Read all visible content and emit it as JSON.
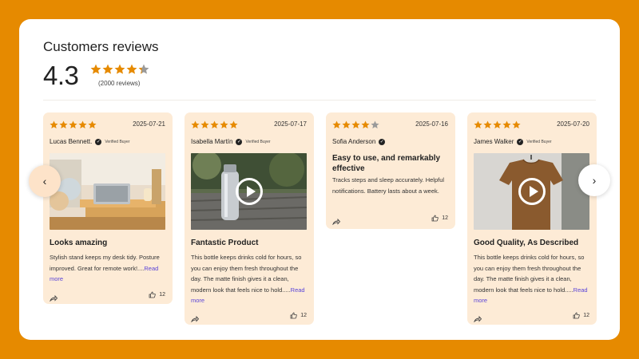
{
  "summary": {
    "title": "Customers reviews",
    "rating": "4.3",
    "rating_value": 4.3,
    "count": "(2000 reviews)"
  },
  "colors": {
    "background": "#E68A00",
    "card": "#FDEBD6",
    "star": "#E68A00",
    "star_empty": "#9a9a9a",
    "link": "#5a44d8"
  },
  "reviews": [
    {
      "stars": 5,
      "date": "2025-07-21",
      "name": "Lucas Bennett.",
      "verified": "Verified Buyer",
      "media": "photo",
      "title": "Looks amazing",
      "body": "Stylish stand keeps my desk tidy. Posture improved. Great for remote work!....",
      "more": "Read more",
      "likes": "12"
    },
    {
      "stars": 5,
      "date": "2025-07-17",
      "name": "Isabella Martín",
      "verified": "Verified Buyer",
      "media": "video",
      "title": "Fantastic Product",
      "body": "This bottle keeps drinks cold for hours, so you can enjoy them fresh throughout the day. The matte finish gives it a clean, modern look that feels nice to hold.....",
      "more": "Read more",
      "likes": "12"
    },
    {
      "stars": 4,
      "date": "2025-07-16",
      "name": "Sofia Anderson",
      "verified": "",
      "media": "none",
      "title": "Easy to use, and remarkably effective",
      "body": "Tracks steps and sleep accurately. Helpful notifications. Battery lasts about a week.",
      "more": "",
      "likes": "12"
    },
    {
      "stars": 5,
      "date": "2025-07-20",
      "name": "James Walker",
      "verified": "Verified Buyer",
      "media": "video",
      "title": "Good Quality, As Described",
      "body": "This bottle keeps drinks cold for hours, so you can enjoy them fresh throughout the day. The matte finish gives it a clean, modern look that feels nice to hold.....",
      "more": "Read more",
      "likes": "12"
    }
  ],
  "nav": {
    "prev_glyph": "‹",
    "next_glyph": "›"
  }
}
